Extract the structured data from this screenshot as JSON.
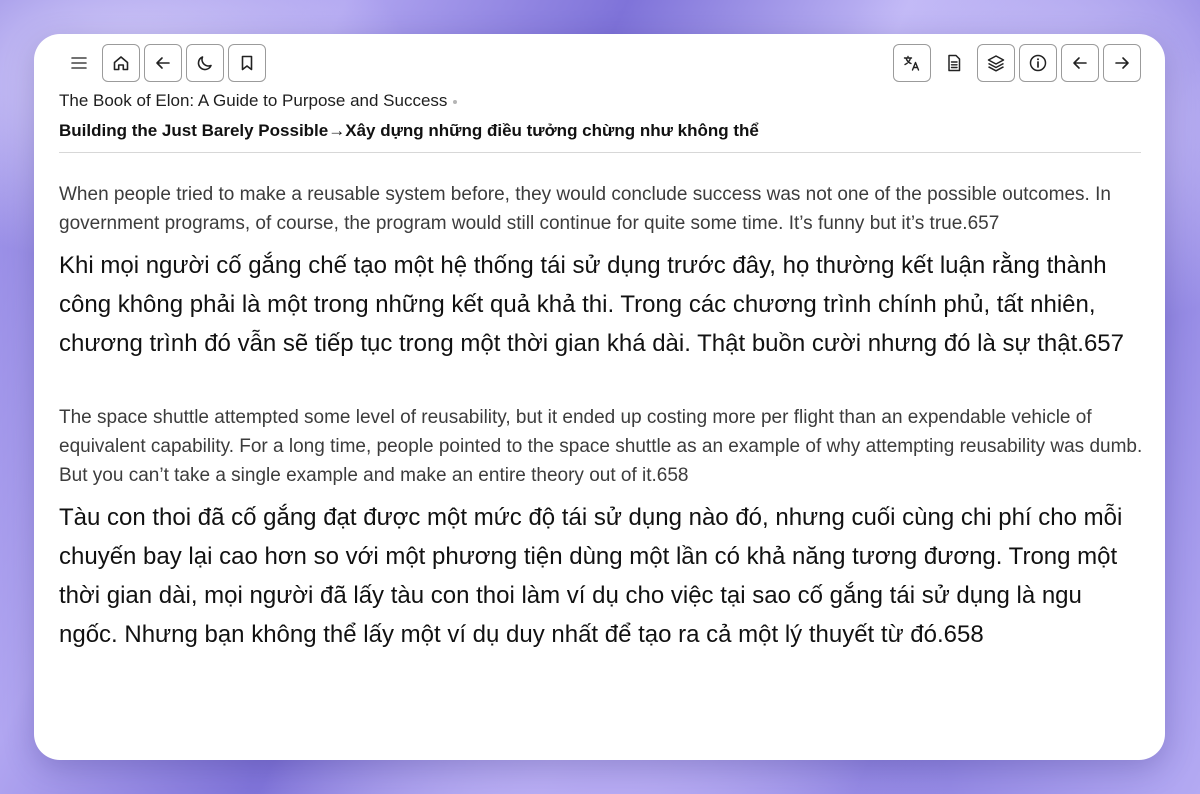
{
  "toolbar": {
    "left": [
      {
        "name": "menu-button",
        "icon": "hamburger-menu-icon"
      },
      {
        "name": "home-button",
        "icon": "home-icon"
      },
      {
        "name": "back-button",
        "icon": "arrow-left-icon"
      },
      {
        "name": "dark-mode-button",
        "icon": "moon-icon"
      },
      {
        "name": "bookmark-button",
        "icon": "bookmark-icon"
      }
    ],
    "right": [
      {
        "name": "translate-button",
        "icon": "translate-icon"
      },
      {
        "name": "document-button",
        "icon": "document-icon"
      },
      {
        "name": "layers-button",
        "icon": "layers-icon"
      },
      {
        "name": "info-button",
        "icon": "info-icon"
      },
      {
        "name": "prev-page-button",
        "icon": "arrow-left-icon"
      },
      {
        "name": "next-page-button",
        "icon": "arrow-right-icon"
      }
    ]
  },
  "header": {
    "book_title": "The Book of Elon: A Guide to Purpose and Success",
    "chapter_title": "Building the Just Barely Possible→Xây dựng những điều tưởng chừng như không thể"
  },
  "content": {
    "paragraphs": [
      {
        "en": "When people tried to make a reusable system before, they would conclude success was not one of the possible outcomes. In government programs, of course, the program would still continue for quite some time. It’s funny but it’s true.657",
        "vi": "Khi mọi người cố gắng chế tạo một hệ thống tái sử dụng trước đây, họ thường kết luận rằng thành công không phải là một trong những kết quả khả thi. Trong các chương trình chính phủ, tất nhiên, chương trình đó vẫn sẽ tiếp tục trong một thời gian khá dài. Thật buồn cười nhưng đó là sự thật.657"
      },
      {
        "en": "The space shuttle attempted some level of reusability, but it ended up costing more per flight than an expendable vehicle of equivalent capability. For a long time, people pointed to the space shuttle as an example of why attempting reusability was dumb. But you can’t take a single example and make an entire theory out of it.658",
        "vi": "Tàu con thoi đã cố gắng đạt được một mức độ tái sử dụng nào đó, nhưng cuối cùng chi phí cho mỗi chuyến bay lại cao hơn so với một phương tiện dùng một lần có khả năng tương đương. Trong một thời gian dài, mọi người đã lấy tàu con thoi làm ví dụ cho việc tại sao cố gắng tái sử dụng là ngu ngốc. Nhưng bạn không thể lấy một ví dụ duy nhất để tạo ra cả một lý thuyết từ đó.658"
      }
    ]
  },
  "colors": {
    "wallpaper": "#9a8fe6",
    "window_bg": "#ffffff",
    "english_text": "#3c3c3c",
    "vietnamese_text": "#111111",
    "button_border": "#9b9b9b"
  }
}
